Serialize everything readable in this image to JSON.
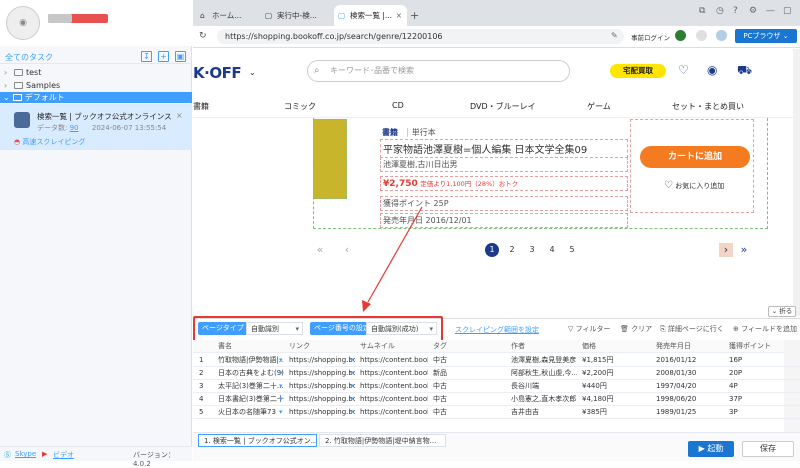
{
  "sidebar": {
    "all_tasks": "全てのタスク",
    "folders": [
      "test",
      "Samples"
    ],
    "default_folder": "デフォルト",
    "task": {
      "title": "検索一覧 | ブックオフ公式オンラインスト...",
      "data_label": "データ数:",
      "data_count": "90",
      "date": "2024-06-07 13:55:54",
      "sub": "高速スクレイピング"
    },
    "footer": {
      "skype": "Skype",
      "video": "ビデオ",
      "version": "バージョン：4.0.2"
    }
  },
  "browser": {
    "tabs": [
      "ホーム...",
      "実行中-検...",
      "検索一覧 |..."
    ],
    "url": "https://shopping.bookoff.co.jp/search/genre/12200106",
    "login": "事前ログイン",
    "pc_browser": "PCブラウザ"
  },
  "site": {
    "logo": "K·OFF",
    "search_placeholder": "キーワード･品番で検索",
    "delivery": "宅配買取",
    "nav": [
      "書籍",
      "コミック",
      "CD",
      "DVD・ブルーレイ",
      "ゲーム",
      "セット・まとめ買い"
    ],
    "product": {
      "category": "書籍",
      "format": "単行本",
      "title": "平家物語池澤夏樹=個人編集 日本文学全集09",
      "author": "池澤夏樹,古川日出男",
      "price": "¥2,750",
      "discount": "定価より1,100円（28%）おトク",
      "points": "獲得ポイント 25P",
      "release": "発売年月日  2016/12/01",
      "cart": "カートに追加",
      "favorite": "お気に入り追加"
    },
    "pagination": [
      "1",
      "2",
      "3",
      "4",
      "5"
    ],
    "collapse": "折る"
  },
  "toolbar": {
    "page_type_label": "ページタイプ",
    "page_type_value": "自動識別",
    "page_num_label": "ページ番号の設定",
    "page_num_value": "自動識別(成功)",
    "scrape_range": "スクレイピング範囲を設定",
    "filter": "フィルター",
    "clear": "クリア",
    "detail": "詳細ページに行く",
    "add_field": "フィールドを追加"
  },
  "table": {
    "headers": [
      "書名",
      "リンク",
      "サムネイル",
      "タグ",
      "作者",
      "価格",
      "発売年月日",
      "獲得ポイント"
    ],
    "rows": [
      [
        "1",
        "竹取物語|伊勢物語|...",
        "https://shopping.booko...",
        "https://content.booko...",
        "中古",
        "池澤夏樹,森見登美彦",
        "¥1,815円",
        "2016/01/12",
        "16P"
      ],
      [
        "2",
        "日本の古典をよむ(9)...",
        "https://shopping.booko...",
        "https://content.booko...",
        "新品",
        "阿部秋生,秋山虔,今...",
        "¥2,200円",
        "2008/01/30",
        "20P"
      ],
      [
        "3",
        "太平記(3)巻第二十...",
        "https://shopping.booko...",
        "https://content.booko...",
        "中古",
        "長谷川端",
        "¥440円",
        "1997/04/20",
        "4P"
      ],
      [
        "4",
        "日本書紀(3)巻第二十...",
        "https://shopping.booko...",
        "https://content.booko...",
        "中古",
        "小島憲之,直木孝次郎...",
        "¥4,180円",
        "1998/06/20",
        "37P"
      ],
      [
        "5",
        "火日本の名随筆73",
        "https://shopping.booko...",
        "https://content.booko...",
        "中古",
        "吉井由吉",
        "¥385円",
        "1989/01/25",
        "3P"
      ]
    ]
  },
  "bottom": {
    "tabs": [
      "1. 検索一覧 | ブックオフ公式オン...",
      "2. 竹取物語|伊勢物語|堤中納言物..."
    ],
    "start": "起動",
    "save": "保存"
  }
}
